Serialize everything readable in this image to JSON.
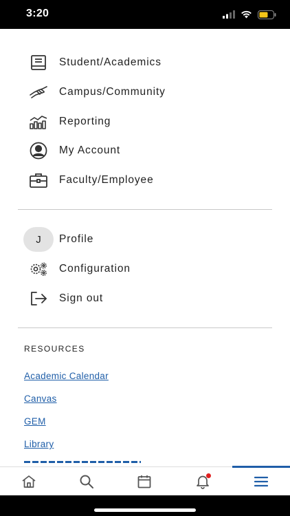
{
  "status_bar": {
    "time": "3:20"
  },
  "menu": {
    "primary": [
      {
        "label": "Student/Academics",
        "icon": "book-icon"
      },
      {
        "label": "Campus/Community",
        "icon": "handshake-icon"
      },
      {
        "label": "Reporting",
        "icon": "chart-icon"
      },
      {
        "label": "My Account",
        "icon": "user-circle-icon"
      },
      {
        "label": "Faculty/Employee",
        "icon": "briefcase-icon"
      }
    ],
    "secondary": [
      {
        "label": "Profile",
        "avatar_initial": "J"
      },
      {
        "label": "Configuration",
        "icon": "gears-icon"
      },
      {
        "label": "Sign out",
        "icon": "sign-out-icon"
      }
    ]
  },
  "resources": {
    "title": "RESOURCES",
    "links": [
      "Academic Calendar",
      "Canvas",
      "GEM",
      "Library"
    ]
  },
  "tab_bar": {
    "tabs": [
      "home-icon",
      "search-icon",
      "calendar-icon",
      "bell-icon",
      "menu-icon"
    ],
    "active": "menu-icon",
    "accent_color": "#1f5ea8",
    "badge_color": "#e02020"
  }
}
